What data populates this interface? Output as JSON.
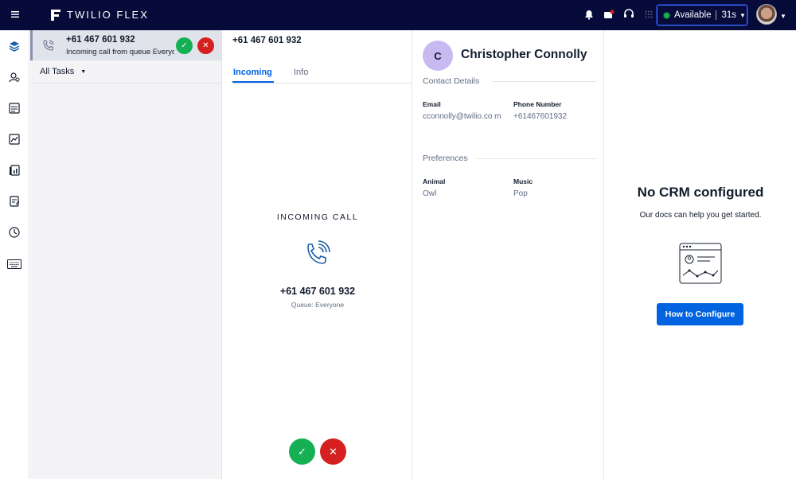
{
  "header": {
    "brand": "TWILIO FLEX",
    "status": "Available",
    "timer": "31s",
    "status_color": "#14b053",
    "icons": [
      "menu-icon",
      "bell-icon",
      "notification-icon",
      "headset-icon",
      "grid-icon"
    ]
  },
  "nav": {
    "icons": [
      "layers-icon",
      "teams-icon",
      "queues-icon",
      "analytics-icon",
      "reports-icon",
      "clipboard-icon",
      "clock-icon",
      "keyboard-icon"
    ]
  },
  "task": {
    "number": "+61 467 601 932",
    "subtitle": "Incoming call from queue Everyone",
    "accept_icon": "✓",
    "reject_icon": "✕"
  },
  "filter": {
    "label": "All Tasks"
  },
  "call": {
    "title": "+61 467 601 932",
    "tabs": [
      "Incoming",
      "Info"
    ],
    "incoming_label": "INCOMING CALL",
    "number": "+61 467 601 932",
    "queue": "Queue: Everyone",
    "accept_icon": "✓",
    "reject_icon": "✕"
  },
  "customer": {
    "initial": "C",
    "name": "Christopher Connolly",
    "contact_section": "Contact Details",
    "email_label": "Email",
    "email_value": "cconnolly@twilio.co m",
    "phone_label": "Phone Number",
    "phone_value": "+61467601932",
    "preferences_section": "Preferences",
    "animal_label": "Animal",
    "animal_value": "Owl",
    "music_label": "Music",
    "music_value": "Pop"
  },
  "crm": {
    "title": "No CRM configured",
    "subtitle": "Our docs can help you get started.",
    "button": "How to Configure"
  },
  "colors": {
    "topbar": "#060b3a",
    "accent": "#0263e0",
    "accept": "#14b053",
    "reject": "#d61f1f"
  }
}
